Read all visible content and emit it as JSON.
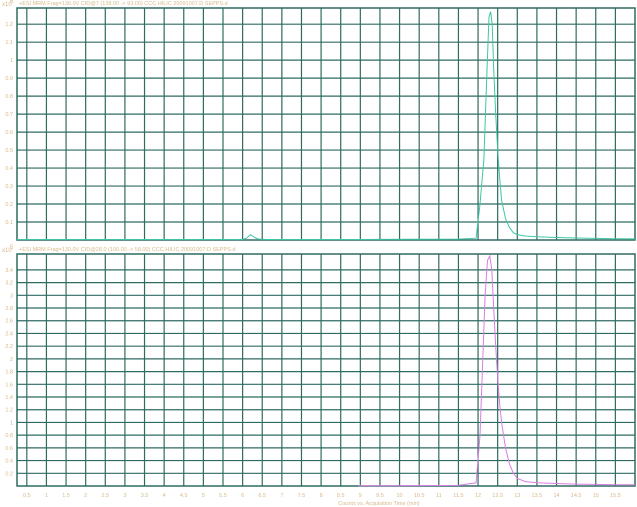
{
  "chart_data": [
    {
      "type": "line",
      "exponent_label": "x10",
      "exponent_power": "6",
      "title": "+ESI MRM Frag=130.0V CID@7 (138.00 -> 93.00) CCC HILIC 20091007.D SEPPS.d",
      "xlim": [
        0.25,
        16
      ],
      "ylim": [
        0,
        1.29
      ],
      "y_ticks": [
        0.1,
        0.2,
        0.3,
        0.4,
        0.5,
        0.6,
        0.7,
        0.8,
        0.9,
        1,
        1.1,
        1.2
      ],
      "y_tick_labels": [
        "0.1",
        "0.2",
        "0.3",
        "0.4",
        "0.5",
        "0.6",
        "0.7",
        "0.8",
        "0.9",
        "1",
        "1.1",
        "1.2"
      ],
      "color": "#3cc7a3",
      "series": [
        {
          "x": [
            0.25,
            6.0,
            6.1,
            6.2,
            6.3,
            6.4,
            6.6,
            9.0,
            11.5,
            11.95,
            12.05,
            12.15,
            12.22,
            12.28,
            12.32,
            12.36,
            12.4,
            12.45,
            12.5,
            12.55,
            12.6,
            12.7,
            12.8,
            12.9,
            13.0,
            13.2,
            13.5,
            14.0,
            14.5,
            15.0,
            15.5,
            16.0
          ],
          "y": [
            0.003,
            0.003,
            0.01,
            0.03,
            0.015,
            0.005,
            0.003,
            0.003,
            0.005,
            0.01,
            0.2,
            0.45,
            0.9,
            1.24,
            1.27,
            1.2,
            0.95,
            0.7,
            0.5,
            0.35,
            0.22,
            0.12,
            0.07,
            0.04,
            0.03,
            0.022,
            0.018,
            0.014,
            0.011,
            0.009,
            0.007,
            0.006
          ]
        }
      ]
    },
    {
      "type": "line",
      "exponent_label": "x10",
      "exponent_power": "5",
      "title": "+ESI MRM Frag=130.0V CID@28.0 (100.00 -> 58.00) CCC HILIC 20091007.D SEPPS.d",
      "xlim": [
        0.25,
        16
      ],
      "ylim": [
        0,
        3.65
      ],
      "y_ticks": [
        0.2,
        0.4,
        0.6,
        0.8,
        1,
        1.2,
        1.4,
        1.6,
        1.8,
        2,
        2.2,
        2.4,
        2.6,
        2.8,
        3,
        3.2,
        3.4
      ],
      "y_tick_labels": [
        "0.2",
        "0.4",
        "0.6",
        "0.8",
        "1",
        "1.2",
        "1.4",
        "1.6",
        "1.8",
        "2",
        "2.2",
        "2.4",
        "2.6",
        "2.8",
        "3",
        "3.2",
        "3.4"
      ],
      "xlabel": "Counts vs. Acquisition Time (min)",
      "x_ticks": [
        0.5,
        1,
        1.5,
        2,
        2.5,
        3,
        3.5,
        4,
        4.5,
        5,
        5.5,
        6,
        6.5,
        7,
        7.5,
        8,
        8.5,
        9,
        9.5,
        10,
        10.5,
        11,
        11.5,
        12,
        12.5,
        13,
        13.5,
        14,
        14.5,
        15,
        15.5
      ],
      "x_tick_labels": [
        "0.5",
        "1",
        "1.5",
        "2",
        "2.5",
        "3",
        "3.5",
        "4",
        "4.5",
        "5",
        "5.5",
        "6",
        "6.5",
        "7",
        "7.5",
        "8",
        "8.5",
        "9",
        "9.5",
        "10",
        "10.5",
        "11",
        "11.5",
        "12",
        "12.5",
        "13",
        "13.5",
        "14",
        "14.5",
        "15",
        "15.5"
      ],
      "color": "#d77ee0",
      "series": [
        {
          "x": [
            8.95,
            9.5,
            10.5,
            11.5,
            11.95,
            12.05,
            12.12,
            12.18,
            12.24,
            12.3,
            12.35,
            12.4,
            12.45,
            12.5,
            12.55,
            12.6,
            12.7,
            12.8,
            12.9,
            13.0,
            13.2,
            13.5,
            14.0,
            14.5,
            15.0,
            15.5,
            16.0
          ],
          "y": [
            0.005,
            0.005,
            0.006,
            0.01,
            0.05,
            0.8,
            2.0,
            3.0,
            3.55,
            3.62,
            3.4,
            2.8,
            2.2,
            1.7,
            1.3,
            1.0,
            0.6,
            0.35,
            0.2,
            0.12,
            0.07,
            0.05,
            0.04,
            0.03,
            0.025,
            0.02,
            0.02
          ]
        }
      ]
    }
  ]
}
